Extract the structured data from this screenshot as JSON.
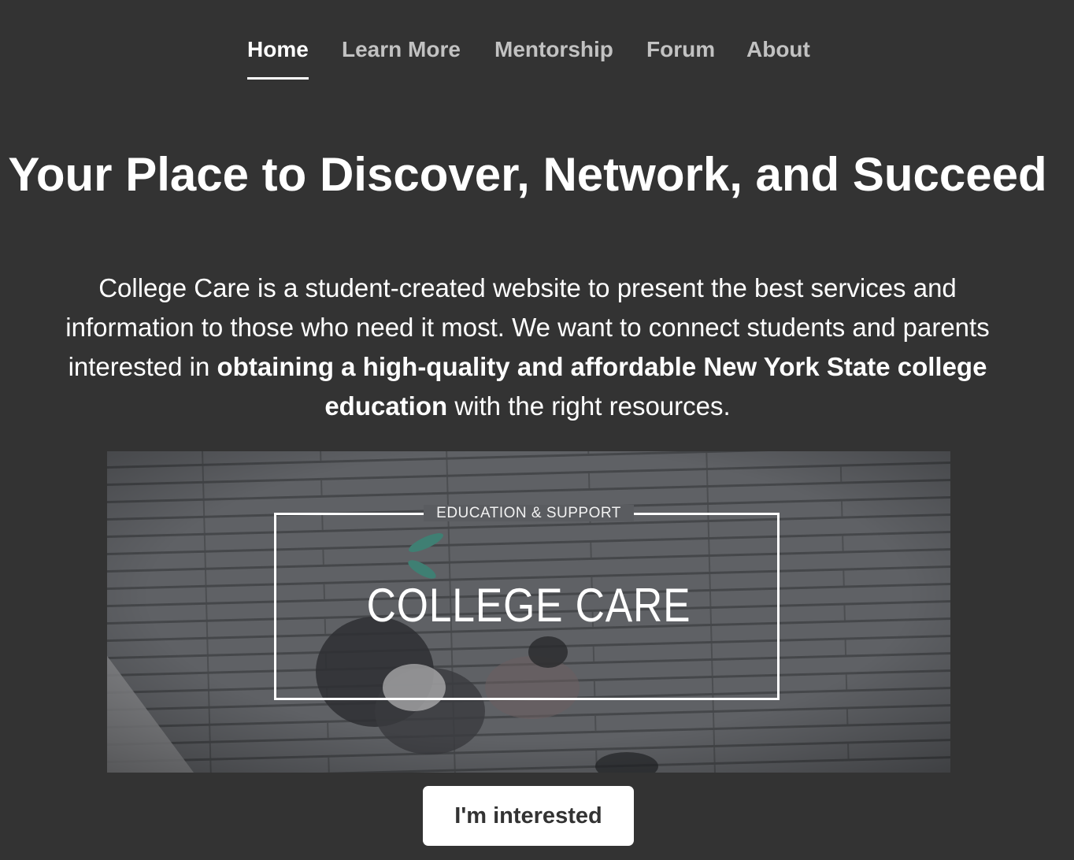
{
  "nav": {
    "items": [
      {
        "label": "Home",
        "active": true
      },
      {
        "label": "Learn More",
        "active": false
      },
      {
        "label": "Mentorship",
        "active": false
      },
      {
        "label": "Forum",
        "active": false
      },
      {
        "label": "About",
        "active": false
      }
    ]
  },
  "hero_text": {
    "headline": "Your Place to Discover, Network, and Succeed",
    "lead_part1": "College Care is a student-created website to present the best services and information to those who need it most. We want to connect students and parents interested in ",
    "lead_bold": "obtaining a high-quality and affordable New York State college education",
    "lead_part2": " with the right resources."
  },
  "banner": {
    "tagline": "EDUCATION & SUPPORT",
    "title": "COLLEGE CARE"
  },
  "cta": {
    "label": "I'm interested"
  },
  "colors": {
    "background": "#333333",
    "nav_inactive": "#c2c2c2",
    "text": "#ffffff",
    "button_bg": "#ffffff",
    "button_text": "#333333"
  }
}
